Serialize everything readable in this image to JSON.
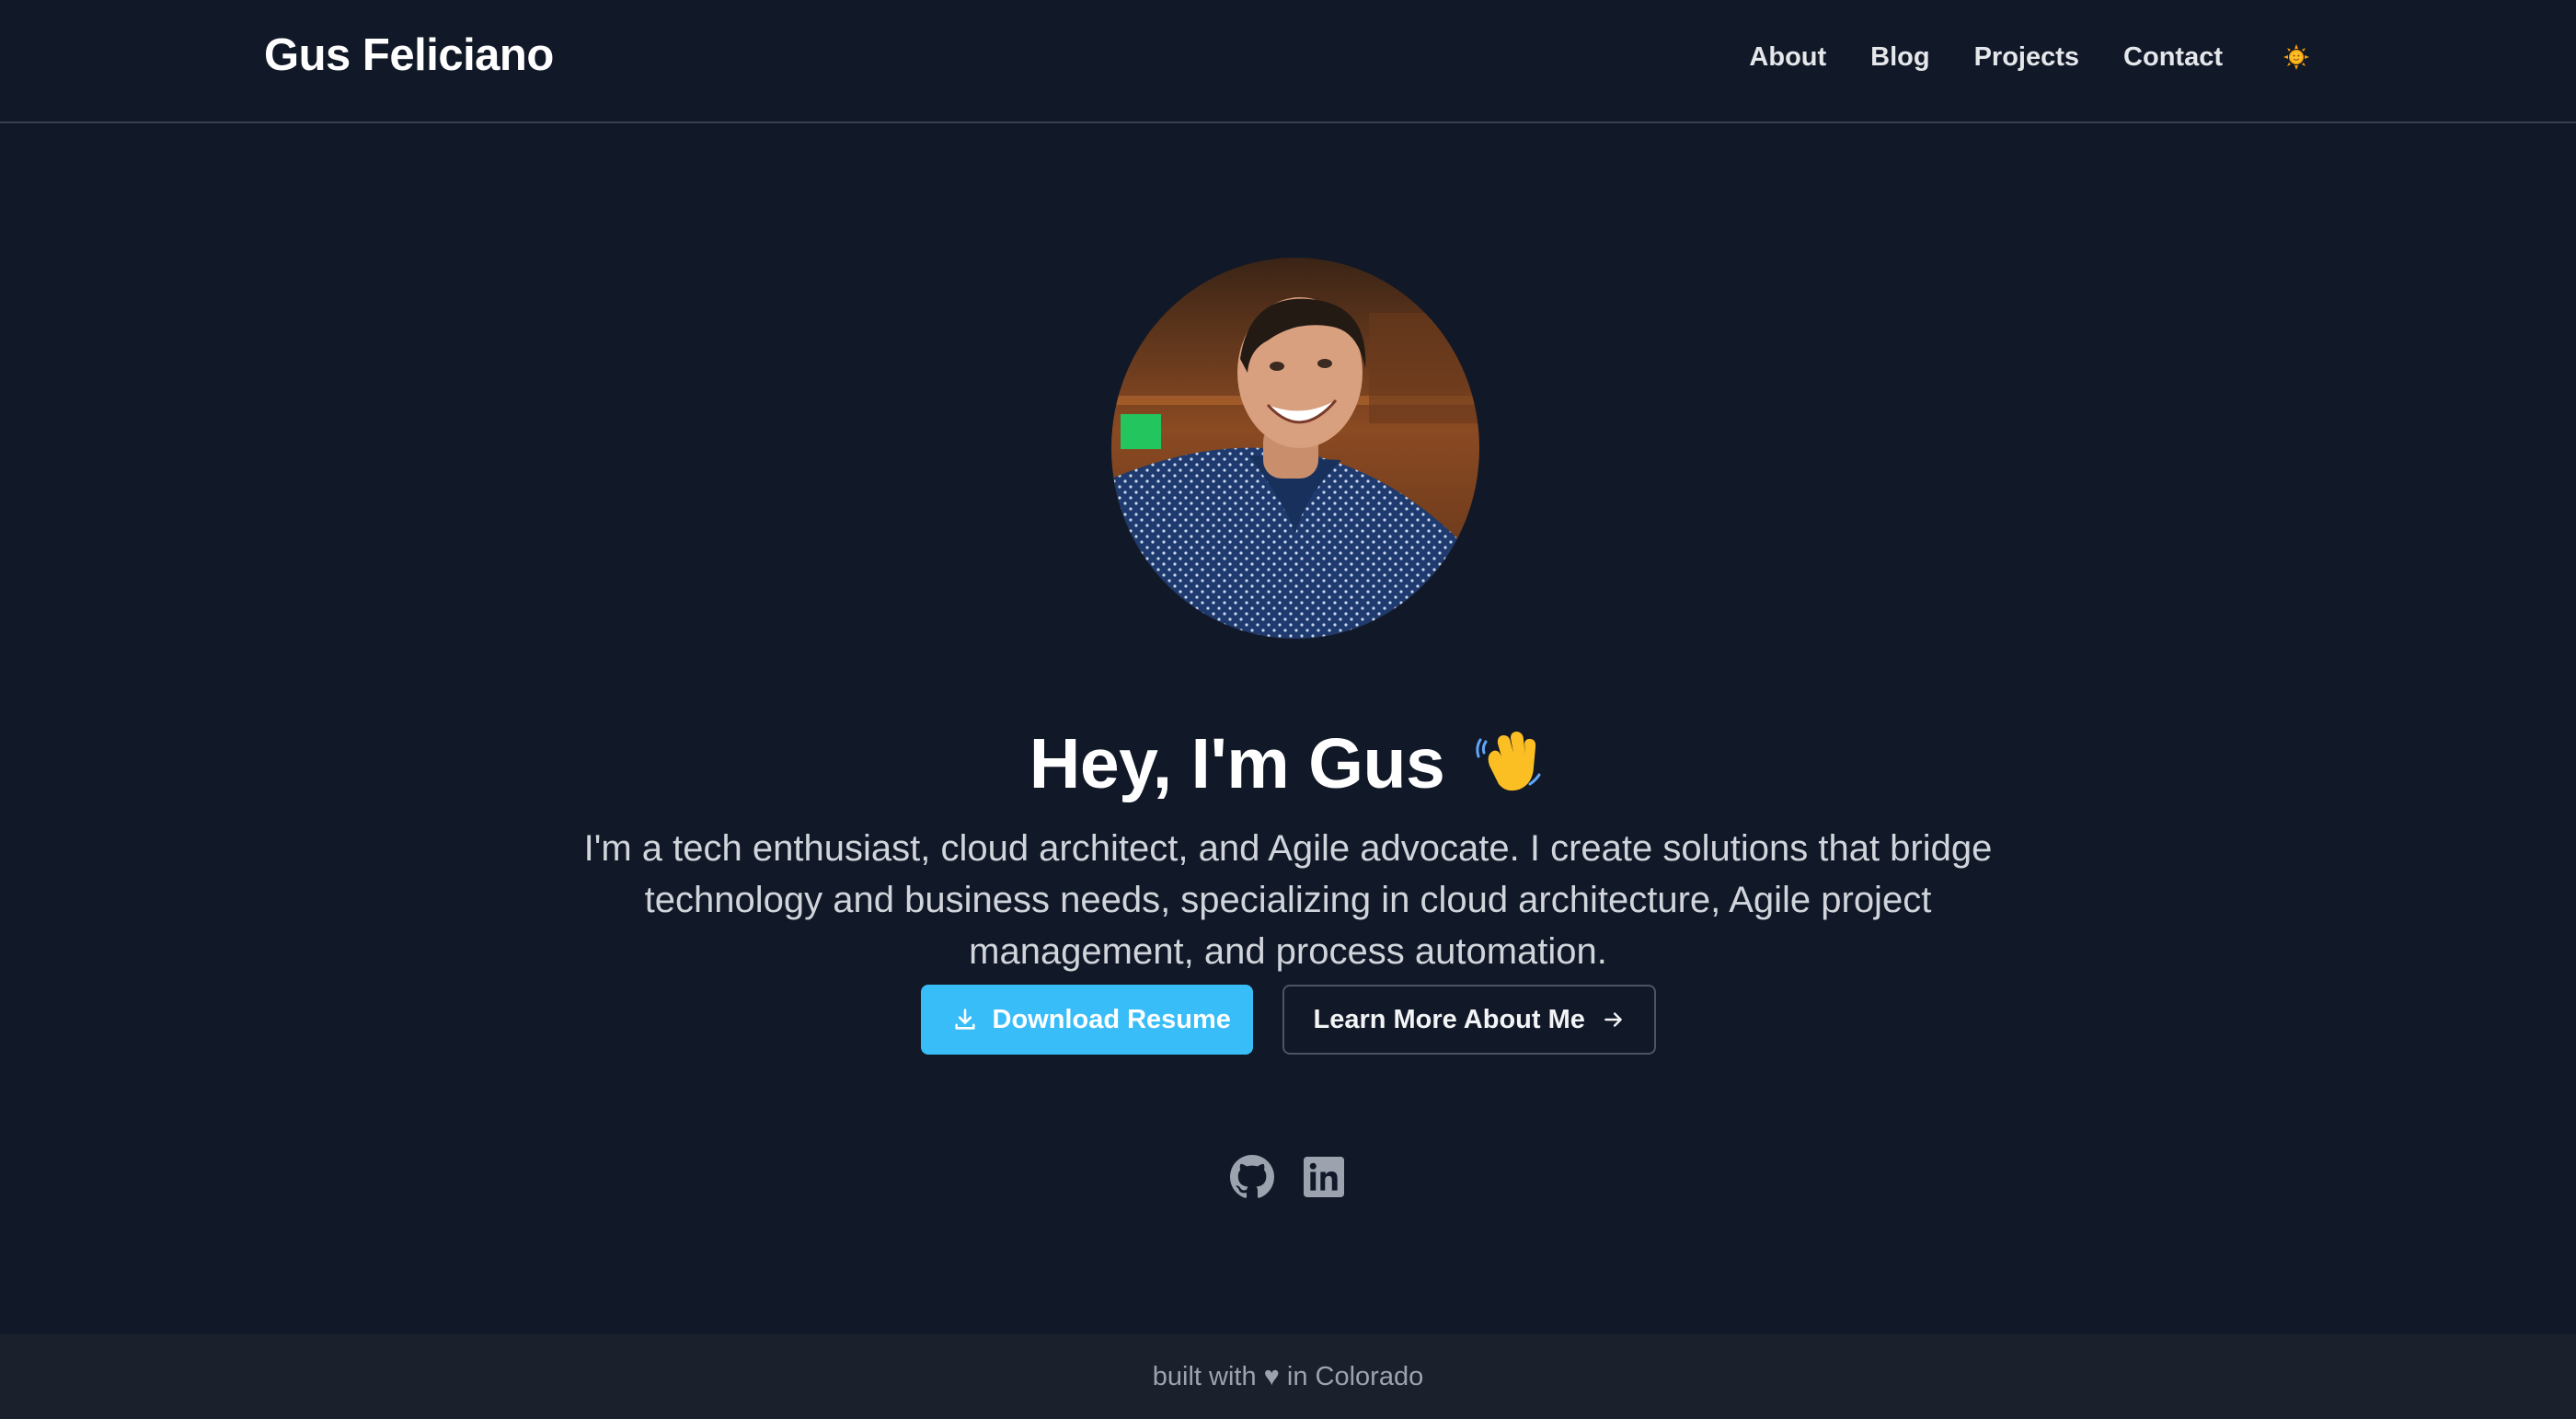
{
  "header": {
    "brand": "Gus Feliciano",
    "nav": [
      {
        "label": "About"
      },
      {
        "label": "Blog"
      },
      {
        "label": "Projects"
      },
      {
        "label": "Contact"
      }
    ],
    "theme_toggle_icon": "sun-emoji-icon"
  },
  "hero": {
    "avatar_icon": "profile-photo",
    "headline": "Hey, I'm Gus",
    "headline_emoji_icon": "waving-hand-icon",
    "intro": "I'm a tech enthusiast, cloud architect, and Agile advocate. I create solutions that bridge technology and business needs, specializing in cloud architecture, Agile project management, and process automation.",
    "primary_button": {
      "label": "Download Resume",
      "icon": "download-icon"
    },
    "secondary_button": {
      "label": "Learn More About Me",
      "icon": "arrow-right-icon"
    },
    "socials": [
      {
        "icon": "github-icon"
      },
      {
        "icon": "linkedin-icon"
      }
    ]
  },
  "footer": {
    "text": "built with ♥ in Colorado"
  },
  "colors": {
    "background": "#111827",
    "accent": "#38bdf8",
    "footer_background": "#1a202c",
    "muted_text": "#9ca3af"
  }
}
